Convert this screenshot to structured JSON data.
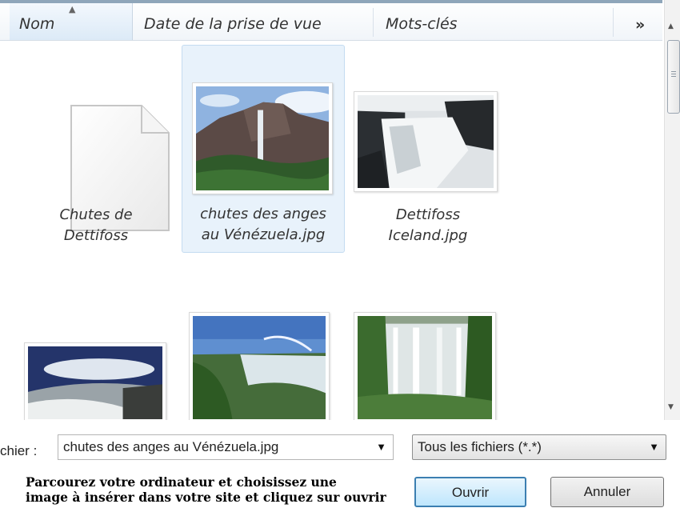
{
  "columns": [
    "Nom",
    "Date de la prise de vue",
    "Mots-clés"
  ],
  "more_columns_glyph": "»",
  "items": [
    {
      "label": [
        "Chutes de",
        "Dettifoss"
      ],
      "kind": "document",
      "selected": false
    },
    {
      "label": [
        "chutes des anges",
        "au Vénézuela.jpg"
      ],
      "kind": "photo",
      "selected": true
    },
    {
      "label": [
        "Dettifoss",
        "Iceland.jpg"
      ],
      "kind": "photo",
      "selected": false
    }
  ],
  "filename": {
    "label": "chier :",
    "value": "chutes des anges au Vénézuela.jpg"
  },
  "filter": {
    "value": "Tous les fichiers (*.*)"
  },
  "buttons": {
    "open": "Ouvrir",
    "cancel": "Annuler"
  },
  "caption": {
    "line1": "Parcourez votre ordinateur et choisissez une",
    "line2": "image à insérer dans votre site et cliquez sur ouvrir"
  }
}
